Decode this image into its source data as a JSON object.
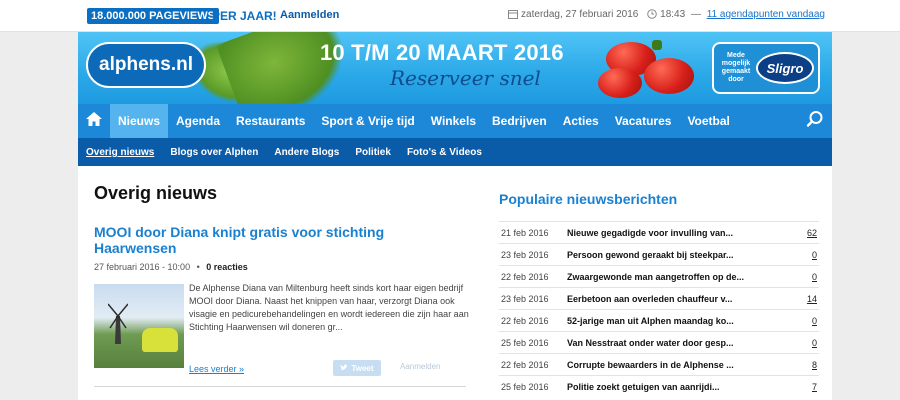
{
  "topbar": {
    "pageviews": "18.000.000 PAGEVIEWS",
    "per_year": "PER JAAR!",
    "login": "Aanmelden",
    "date": "zaterdag, 27 februari 2016",
    "time": "18:43",
    "agenda_link": "11 agendapunten vandaag"
  },
  "banner": {
    "logo": "alphens.nl",
    "promo_title": "10 T/M 20 MAART 2016",
    "promo_sub": "Reserveer snel",
    "sponsor_small": "Mede mogelijk gemaakt door",
    "sponsor_logo": "Sligro"
  },
  "nav": {
    "items": [
      "Nieuws",
      "Agenda",
      "Restaurants",
      "Sport & Vrije tijd",
      "Winkels",
      "Bedrijven",
      "Acties",
      "Vacatures",
      "Voetbal"
    ],
    "active": "Nieuws"
  },
  "subnav": {
    "items": [
      "Overig nieuws",
      "Blogs over Alphen",
      "Andere Blogs",
      "Politiek",
      "Foto's & Videos"
    ]
  },
  "main": {
    "page_title": "Overig nieuws",
    "article": {
      "title": "MOOI door Diana knipt gratis voor stichting Haarwensen",
      "date": "27 februari 2016 - 10:00",
      "reactions": "0 reacties",
      "excerpt": "De Alphense Diana van Miltenburg heeft sinds kort haar eigen bedrijf MOOI door Diana. Naast het knippen van haar, verzorgt Diana ook visagie en pedicurebehandelingen en wordt iedereen die zijn haar aan Stichting Haarwensen wil doneren gr...",
      "read_more": "Lees verder »",
      "tweet": "Tweet",
      "login": "Aanmelden"
    }
  },
  "popular": {
    "title": "Populaire nieuwsberichten",
    "rows": [
      {
        "date": "21 feb 2016",
        "title": "Nieuwe gegadigde voor invulling van...",
        "count": "62"
      },
      {
        "date": "23 feb 2016",
        "title": "Persoon gewond geraakt bij steekpar...",
        "count": "0"
      },
      {
        "date": "22 feb 2016",
        "title": "Zwaargewonde man aangetroffen op de...",
        "count": "0"
      },
      {
        "date": "23 feb 2016",
        "title": "Eerbetoon aan overleden chauffeur v...",
        "count": "14"
      },
      {
        "date": "22 feb 2016",
        "title": "52-jarige man uit Alphen maandag ko...",
        "count": "0"
      },
      {
        "date": "25 feb 2016",
        "title": "Van Nesstraat onder water door gesp...",
        "count": "0"
      },
      {
        "date": "22 feb 2016",
        "title": "Corrupte bewaarders in de Alphense ...",
        "count": "8"
      },
      {
        "date": "25 feb 2016",
        "title": "Politie zoekt getuigen van aanrijdi...",
        "count": "7"
      }
    ]
  },
  "colors": {
    "brand_blue": "#1e88d8",
    "dark_blue": "#0a5ba8",
    "link_blue": "#1a80d0"
  }
}
